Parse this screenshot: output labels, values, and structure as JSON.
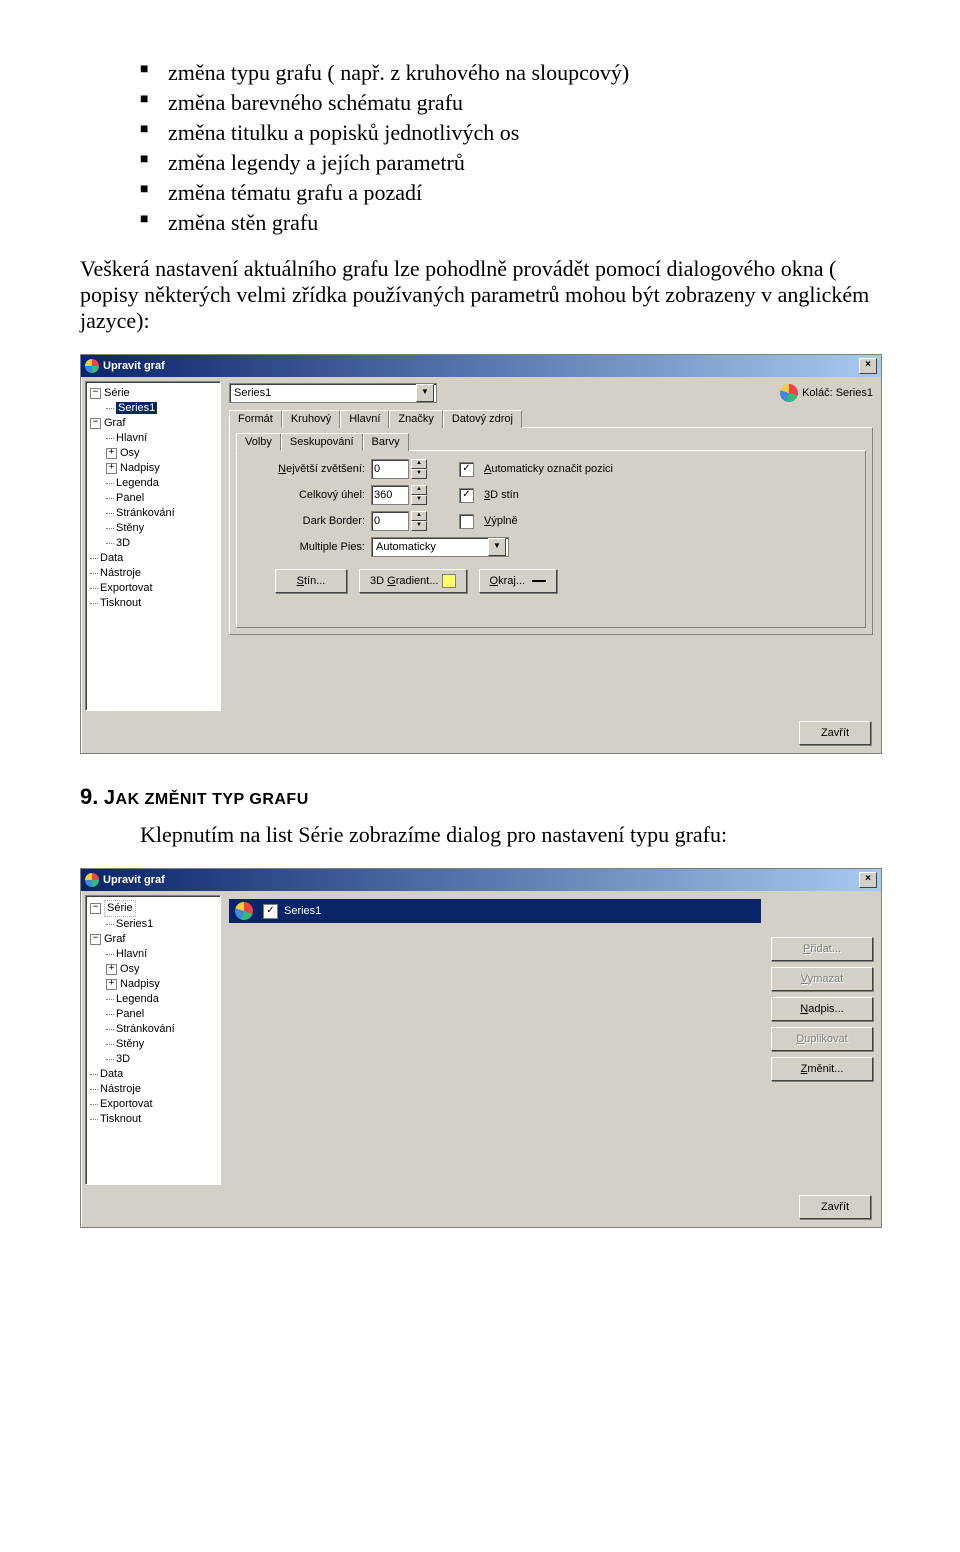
{
  "bullets": [
    "změna typu grafu ( např. z kruhového na sloupcový)",
    "změna barevného schématu grafu",
    "změna titulku a popisků jednotlivých os",
    "změna legendy a jejích parametrů",
    "změna tématu grafu a pozadí",
    "změna stěn grafu"
  ],
  "para1": "Veškerá nastavení aktuálního grafu lze pohodlně provádět pomocí dialogového okna ( popisy některých velmi zřídka používaných parametrů mohou být zobrazeny v anglickém jazyce):",
  "dialog1": {
    "title": "Upravit graf",
    "series_combo": "Series1",
    "pie_label": "Koláč: Series1",
    "tabs_row1": [
      "Formát",
      "Kruhový",
      "Hlavní",
      "Značky",
      "Datový zdroj"
    ],
    "tabs_row2": [
      "Volby",
      "Seskupování",
      "Barvy"
    ],
    "tree": {
      "serie": "Série",
      "series1": "Series1",
      "graf": "Graf",
      "hlavni": "Hlavní",
      "osy": "Osy",
      "nadpisy": "Nadpisy",
      "legenda": "Legenda",
      "panel": "Panel",
      "strankovani": "Stránkování",
      "steny": "Stěny",
      "3d": "3D",
      "data": "Data",
      "nastroje": "Nástroje",
      "export": "Exportovat",
      "tisk": "Tisknout"
    },
    "form": {
      "zvetseni_label": "Největší zvětšení:",
      "zvetseni_val": "0",
      "auto_label": "Automaticky označit pozici",
      "auto_checked": "✓",
      "uhel_label": "Celkový úhel:",
      "uhel_val": "360",
      "stin_label": "3D stín",
      "stin_checked": "✓",
      "border_label": "Dark Border:",
      "border_val": "0",
      "vyplne_label": "Výplně",
      "pies_label": "Multiple Pies:",
      "pies_val": "Automaticky",
      "btn_stin": "Stín...",
      "btn_grad": "3D Gradient...",
      "btn_okraj": "Okraj... "
    },
    "close": "Zavřít"
  },
  "section": {
    "num": "9.",
    "title": "Jak změnit typ grafu"
  },
  "para2": "Klepnutím na list Série zobrazíme dialog pro nastavení typu grafu:",
  "dialog2": {
    "title": "Upravit graf",
    "tree": {
      "serie": "Série",
      "series1": "Series1",
      "graf": "Graf",
      "hlavni": "Hlavní",
      "osy": "Osy",
      "nadpisy": "Nadpisy",
      "legenda": "Legenda",
      "panel": "Panel",
      "strankovani": "Stránkování",
      "steny": "Stěny",
      "3d": "3D",
      "data": "Data",
      "nastroje": "Nástroje",
      "export": "Exportovat",
      "tisk": "Tisknout"
    },
    "series_item": "Series1",
    "series_checked": "✓",
    "buttons": {
      "pridat": "Přidat...",
      "vymazat": "Vymazat",
      "nadpis": "Nadpis...",
      "dup": "Duplikovat",
      "zmenit": "Změnit..."
    },
    "close": "Zavřít"
  }
}
